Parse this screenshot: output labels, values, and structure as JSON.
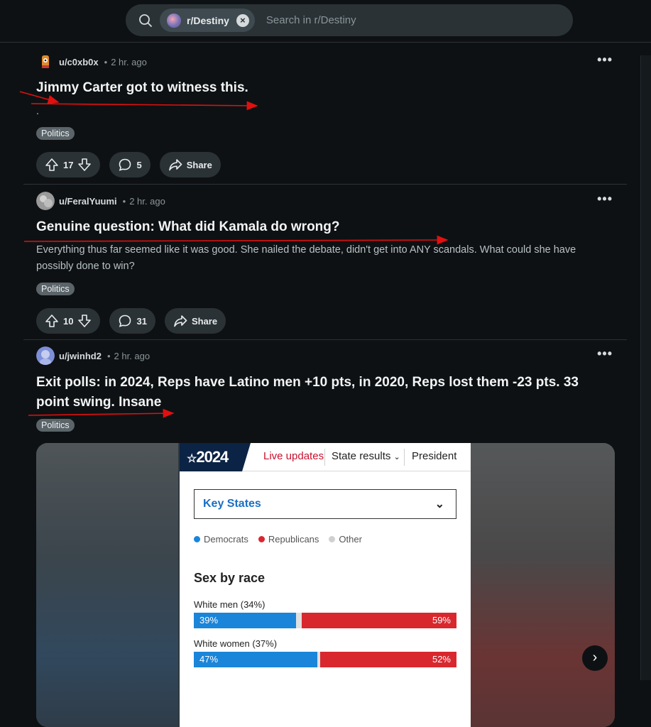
{
  "search": {
    "community": "r/Destiny",
    "placeholder": "Search in r/Destiny"
  },
  "posts": [
    {
      "user": "u/c0xb0x",
      "time": "2 hr. ago",
      "title": "Jimmy Carter got to witness this.",
      "body": ".",
      "flair": "Politics",
      "votes": "17",
      "comments": "5",
      "share": "Share"
    },
    {
      "user": "u/FeralYuumi",
      "time": "2 hr. ago",
      "title": "Genuine question: What did Kamala do wrong?",
      "body": "Everything thus far seemed like it was good. She nailed the debate, didn't get into ANY scandals. What could she have possibly done to win?",
      "flair": "Politics",
      "votes": "10",
      "comments": "31",
      "share": "Share"
    },
    {
      "user": "u/jwinhd2",
      "time": "2 hr. ago",
      "title_line1": "Exit polls: in 2024, Reps have Latino men +10 pts, in 2020, Reps lost them -23 pts. 33",
      "title_line2": "point swing. Insane",
      "flair": "Politics"
    }
  ],
  "image": {
    "logo": "2024",
    "tabs": [
      "Live updates",
      "State results",
      "President"
    ],
    "dropdown": "Key States",
    "legend": [
      "Democrats",
      "Republicans",
      "Other"
    ],
    "heading": "Sex by race",
    "rows": [
      {
        "label": "White men (34%)",
        "dem": "39%",
        "rep": "59%",
        "dem_frac": 0.39,
        "rep_frac": 0.59
      },
      {
        "label": "White women (37%)",
        "dem": "47%",
        "rep": "52%",
        "dem_frac": 0.47,
        "rep_frac": 0.52
      }
    ]
  },
  "colors": {
    "background": "#0e1113",
    "pill": "#2a3236",
    "democrats": "#1a85d9",
    "republicans": "#d9272e",
    "annotation": "#e01010"
  }
}
